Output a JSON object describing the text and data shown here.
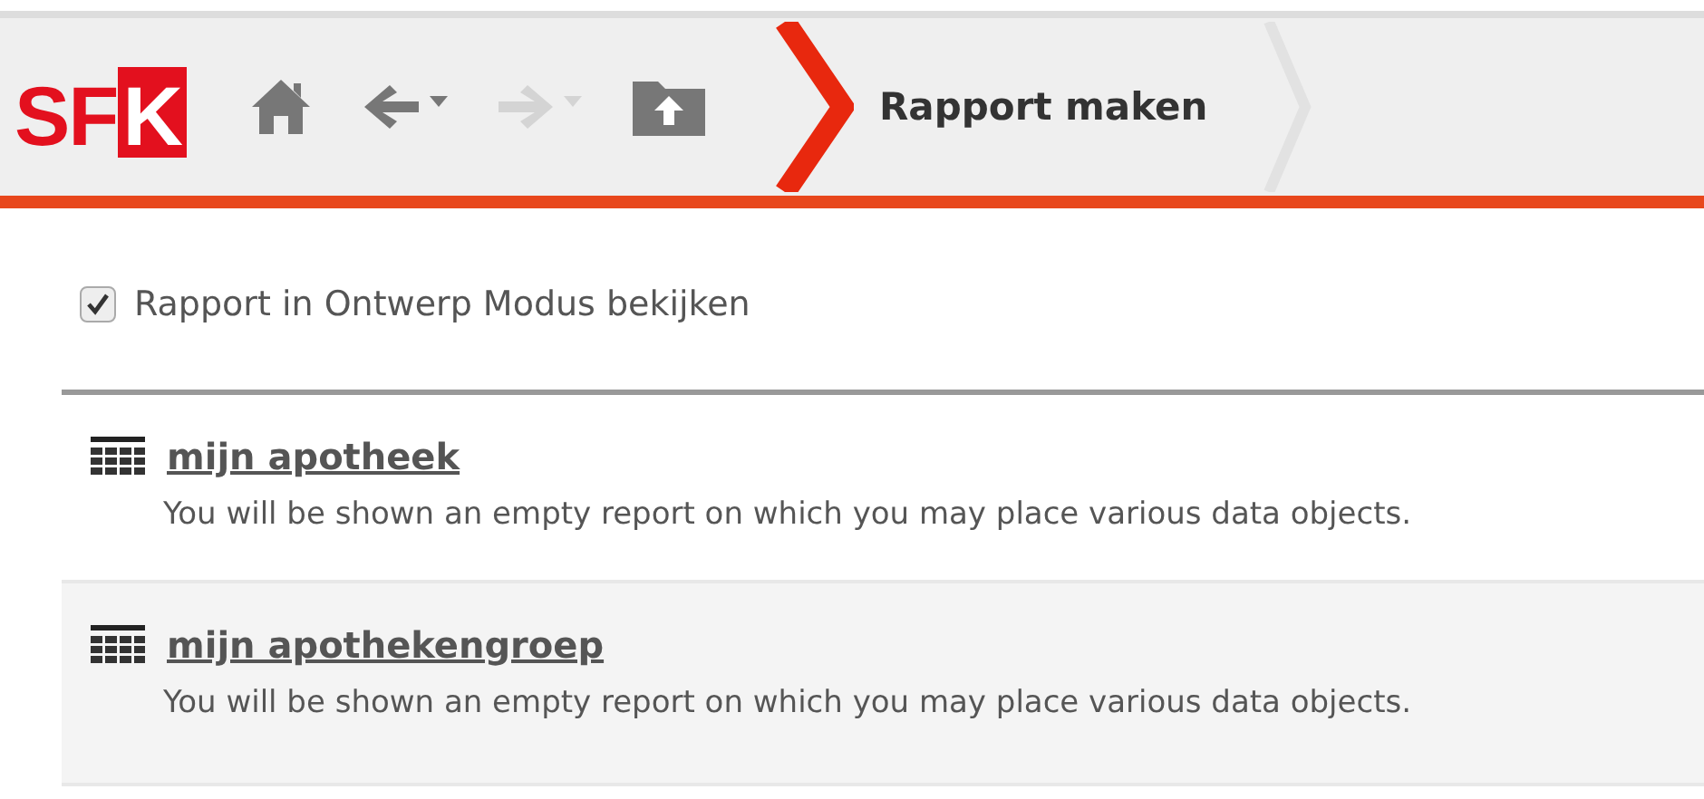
{
  "toolbar": {
    "logo": {
      "plain": "SF",
      "boxed": "K"
    },
    "nav": [
      {
        "kind": "home",
        "disabled": false
      },
      {
        "kind": "back",
        "disabled": false,
        "dropdown": true
      },
      {
        "kind": "forward",
        "disabled": true,
        "dropdown": true
      },
      {
        "kind": "up",
        "disabled": false
      }
    ],
    "breadcrumb": [
      {
        "label": "Rapport maken",
        "selected": true
      }
    ]
  },
  "design_mode": {
    "label": "Rapport in Ontwerp Modus bekijken",
    "checked": true
  },
  "reports": [
    {
      "title": "mijn apotheek",
      "description": "You will be shown an empty report on which you may place various data objects.",
      "selected": false
    },
    {
      "title": "mijn apothekengroep",
      "description": "You will be shown an empty report on which you may place various data objects.",
      "selected": true
    }
  ]
}
